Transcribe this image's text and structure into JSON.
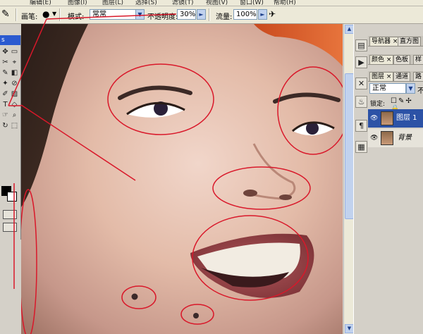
{
  "menubar": {
    "items": [
      "编辑(E)",
      "图像(I)",
      "图层(L)",
      "选择(S)",
      "滤镜(T)",
      "视图(V)",
      "窗口(W)",
      "帮助(H)"
    ]
  },
  "options_bar": {
    "brush_label": "画笔:",
    "mode_label": "模式:",
    "mode_value": "常常",
    "opacity_label": "不透明度:",
    "opacity_value": "30%",
    "flow_label": "流量:",
    "flow_value": "100%"
  },
  "toolbox": {
    "header": "s",
    "tools": [
      "✥",
      "▭",
      "✂",
      "⌖",
      "✎",
      "◧",
      "✦",
      "⊘",
      "✐",
      "▨",
      "T",
      "◇",
      "☞",
      "⌕",
      "↻",
      "⬚"
    ]
  },
  "right_panels": {
    "tab_group1": [
      "导航器 ×",
      "直方图"
    ],
    "tab_group2": [
      "颜色 ×",
      "色板",
      "样"
    ],
    "tab_group3": [
      "图层 ×",
      "通道",
      "路"
    ],
    "blend_mode": "正常",
    "opacity_short": "不",
    "lock_label": "锁定:",
    "layers": [
      {
        "name": "图层 1",
        "selected": true
      },
      {
        "name": "背景",
        "selected": false
      }
    ]
  },
  "colors": {
    "annotation": "#d9182a",
    "selection": "#2c52a6",
    "panel": "#d4d0c8"
  },
  "icons": [
    "brush-icon",
    "airbrush-icon",
    "eye-icon",
    "lock-icon",
    "dropdown-icon",
    "navigator-icon",
    "history-icon"
  ]
}
